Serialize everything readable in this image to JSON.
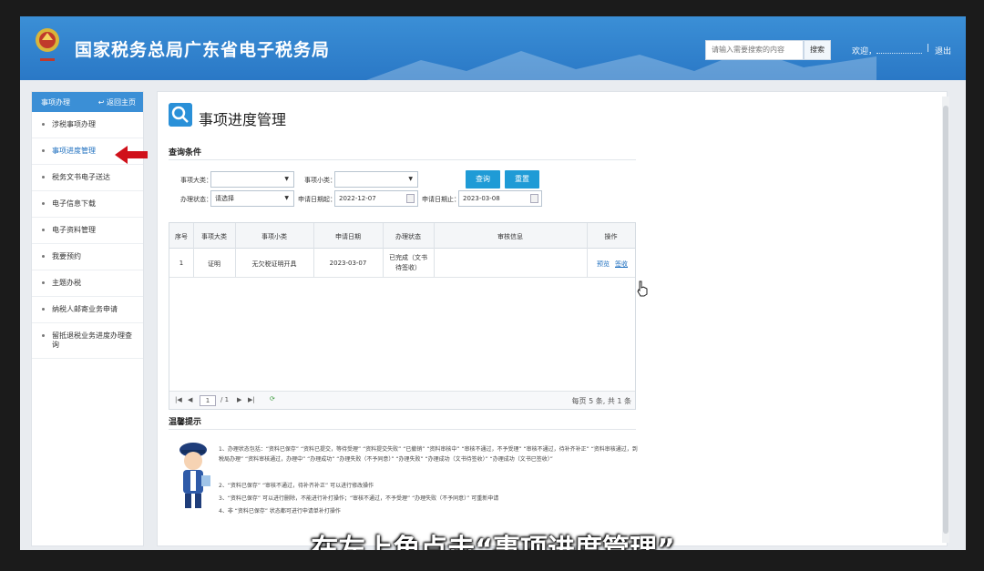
{
  "header": {
    "title": "国家税务总局广东省电子税务局",
    "search_placeholder": "请输入需要搜索的内容",
    "search_button": "搜索",
    "welcome": "欢迎，",
    "logout": "退出"
  },
  "sidebar": {
    "header_title": "事项办理",
    "back_home": "返回主页",
    "items": [
      {
        "label": "涉税事项办理"
      },
      {
        "label": "事项进度管理"
      },
      {
        "label": "税务文书电子送达"
      },
      {
        "label": "电子信息下载"
      },
      {
        "label": "电子资料管理"
      },
      {
        "label": "我要预约"
      },
      {
        "label": "主题办税"
      },
      {
        "label": "纳税人邮寄业务申请"
      },
      {
        "label": "留抵退税业务进度办理查询"
      }
    ]
  },
  "main": {
    "page_title": "事项进度管理",
    "query_title": "查询条件",
    "filters": {
      "major_label": "事项大类：",
      "major_value": "",
      "minor_label": "事项小类：",
      "minor_value": "",
      "status_label": "办理状态：",
      "status_value": "请选择",
      "date_from_label": "申请日期起：",
      "date_from": "2022-12-07",
      "date_to_label": "申请日期止：",
      "date_to": "2023-03-08"
    },
    "query_button": "查询",
    "reset_button": "重置",
    "table": {
      "headers": [
        "序号",
        "事项大类",
        "事项小类",
        "申请日期",
        "办理状态",
        "审核信息",
        "操作"
      ],
      "rows": [
        {
          "no": "1",
          "major": "证明",
          "minor": "无欠税证明开具",
          "date": "2023-03-07",
          "status": "已完成（文书待签收）",
          "audit": "",
          "action_preview": "预览",
          "action_sign": "签收"
        }
      ]
    },
    "pager": {
      "page": "1",
      "total_pages": "/ 1",
      "summary": "每页 5 条, 共 1 条"
    },
    "tips_title": "温馨提示",
    "tips": [
      "1、办理状态包括：“资料已保存” “资料已提交，等待受理” “资料提交失败” “已撤销” “资料审核中” “审核不通过，不予受理” “审核不通过，待补齐补正” “资料审核通过，到税局办理” “资料审核通过，办理中” “办理成功” “办理失败（不予同意）” “办理失败” “办理成功（文书待签收）” “办理成功（文书已签收）”",
      "2、“资料已保存” “审核不通过，待补齐补正” 可以进行修改操作",
      "3、“资料已保存” 可以进行删除，不能进行补打操作；“审核不通过，不予受理” “办理失败（不予同意）” 可重新申请",
      "4、非 “资料已保存” 状态都可进行申请单补打操作"
    ]
  },
  "subtitle": "在左上角点击“事项进度管理”",
  "colors": {
    "header_blue": "#2a78c6",
    "button_blue": "#1f9bd6",
    "arrow_red": "#d0101a"
  }
}
